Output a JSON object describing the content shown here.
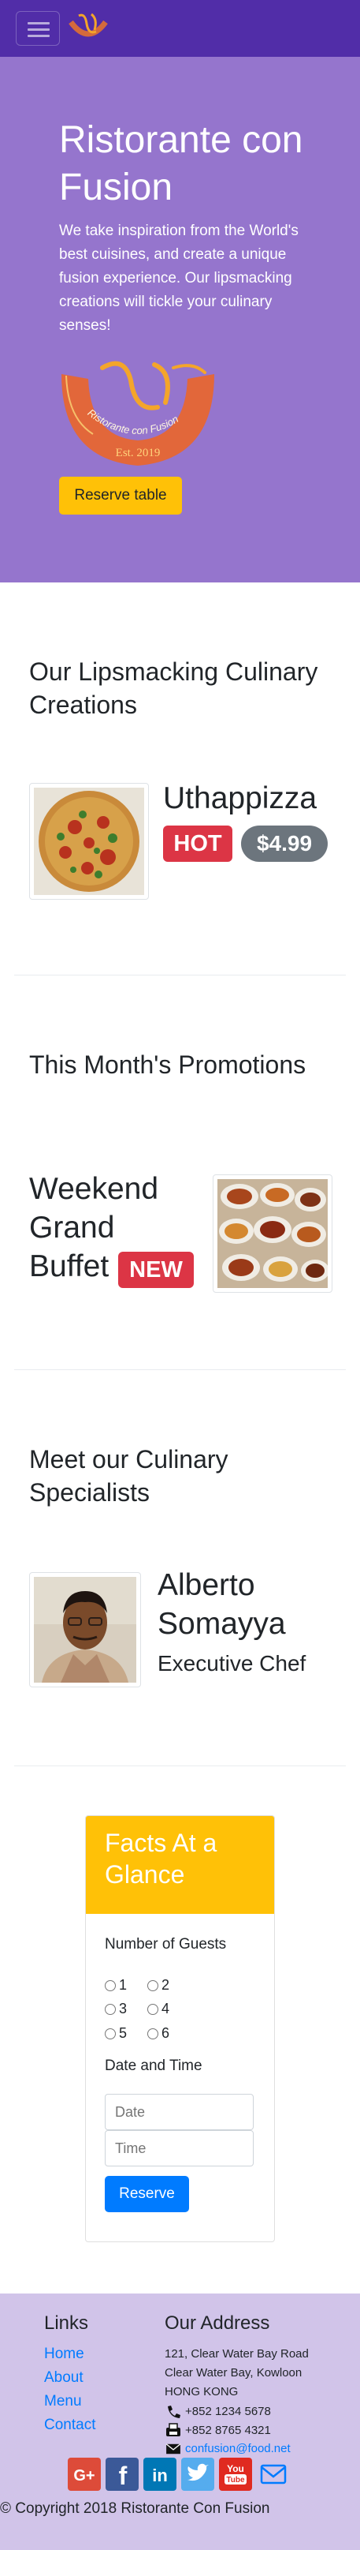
{
  "nav": {
    "toggler_icon": "hamburger-icon",
    "logo_icon": "logo-icon"
  },
  "jumbotron": {
    "title": "Ristorante con Fusion",
    "description": "We take inspiration from the World's best cuisines, and create a unique fusion experience. Our lipsmacking creations will tickle your culinary senses!",
    "logo_text": "Ristorante con Fusion",
    "logo_est": "Est. 2019",
    "reserve_label": "Reserve table"
  },
  "dish": {
    "section_title": "Our Lipsmacking Culinary Creations",
    "name": "Uthappizza",
    "badge": "HOT",
    "price": "$4.99"
  },
  "promotion": {
    "section_title": "This Month's Promotions",
    "name": "Weekend Grand Buffet",
    "badge": "NEW"
  },
  "leader": {
    "section_title": "Meet our Culinary Specialists",
    "name": "Alberto Somayya",
    "designation": "Executive Chef"
  },
  "reservation": {
    "title": "Facts At a Glance",
    "guests_label": "Number of Guests",
    "guest_options": [
      "1",
      "2",
      "3",
      "4",
      "5",
      "6"
    ],
    "datetime_label": "Date and Time",
    "date_placeholder": "Date",
    "time_placeholder": "Time",
    "submit_label": "Reserve"
  },
  "footer": {
    "links_title": "Links",
    "links": [
      "Home",
      "About",
      "Menu",
      "Contact"
    ],
    "address_title": "Our Address",
    "address_lines": [
      "121, Clear Water Bay Road",
      "Clear Water Bay, Kowloon",
      "HONG KONG"
    ],
    "phone": "+852 1234 5678",
    "fax": "+852 8765 4321",
    "email": "confusion@food.net",
    "social_icons": [
      "google-plus-icon",
      "facebook-icon",
      "linkedin-icon",
      "twitter-icon",
      "youtube-icon",
      "mail-icon"
    ],
    "copyright": "© Copyright 2018 Ristorante Con Fusion"
  },
  "colors": {
    "navbar": "#512da8",
    "jumbotron": "#9575cd",
    "footer": "#d1c4e9",
    "accent_yellow": "#ffc107",
    "badge_red": "#dc3545",
    "badge_gray": "#6c757d",
    "primary_blue": "#007bff"
  }
}
